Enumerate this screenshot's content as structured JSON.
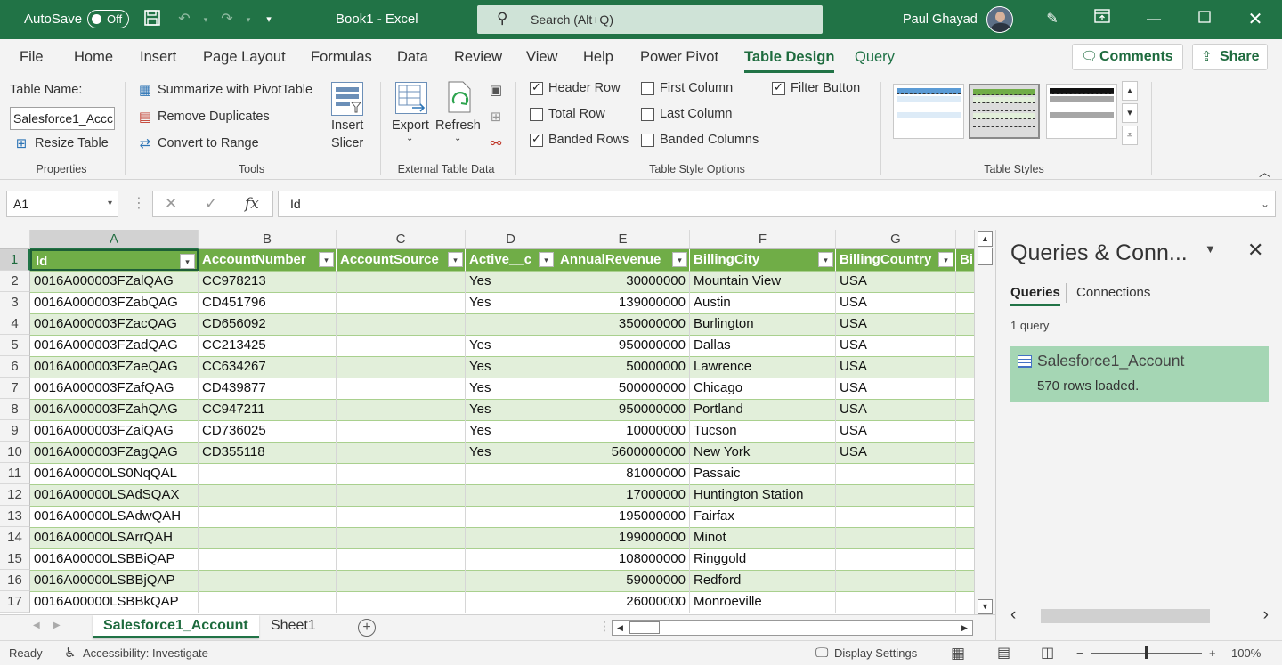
{
  "titlebar": {
    "autosave_label": "AutoSave",
    "autosave_state": "Off",
    "doc_title": "Book1  -  Excel",
    "search_placeholder": "Search (Alt+Q)",
    "user_name": "Paul Ghayad"
  },
  "tabs": [
    "File",
    "Home",
    "Insert",
    "Page Layout",
    "Formulas",
    "Data",
    "Review",
    "View",
    "Help",
    "Power Pivot",
    "Table Design",
    "Query"
  ],
  "active_tab": "Table Design",
  "actions": {
    "comments": "Comments",
    "share": "Share"
  },
  "ribbon": {
    "properties": {
      "table_name_label": "Table Name:",
      "table_name_value": "Salesforce1_Accc",
      "resize": "Resize Table",
      "group": "Properties"
    },
    "tools": {
      "summarize": "Summarize with PivotTable",
      "remove_dup": "Remove Duplicates",
      "convert": "Convert to Range",
      "insert_slicer_1": "Insert",
      "insert_slicer_2": "Slicer",
      "group": "Tools"
    },
    "external": {
      "export": "Export",
      "refresh": "Refresh",
      "group": "External Table Data"
    },
    "style_options": {
      "header_row": "Header Row",
      "total_row": "Total Row",
      "banded_rows": "Banded Rows",
      "first_column": "First Column",
      "last_column": "Last Column",
      "banded_columns": "Banded Columns",
      "filter_button": "Filter Button",
      "group": "Table Style Options"
    },
    "styles": {
      "group": "Table Styles"
    }
  },
  "formula_bar": {
    "name_box": "A1",
    "fx": "fx",
    "formula": "Id"
  },
  "grid": {
    "columns": [
      "A",
      "B",
      "C",
      "D",
      "E",
      "F",
      "G"
    ],
    "headers": [
      "Id",
      "AccountNumber",
      "AccountSource",
      "Active__c",
      "AnnualRevenue",
      "BillingCity",
      "BillingCountry",
      "Bil"
    ],
    "rows": [
      [
        "0016A000003FZalQAG",
        "CC978213",
        "",
        "Yes",
        "30000000",
        "Mountain View",
        "USA"
      ],
      [
        "0016A000003FZabQAG",
        "CD451796",
        "",
        "Yes",
        "139000000",
        "Austin",
        "USA"
      ],
      [
        "0016A000003FZacQAG",
        "CD656092",
        "",
        "",
        "350000000",
        "Burlington",
        "USA"
      ],
      [
        "0016A000003FZadQAG",
        "CC213425",
        "",
        "Yes",
        "950000000",
        "Dallas",
        "USA"
      ],
      [
        "0016A000003FZaeQAG",
        "CC634267",
        "",
        "Yes",
        "50000000",
        "Lawrence",
        "USA"
      ],
      [
        "0016A000003FZafQAG",
        "CD439877",
        "",
        "Yes",
        "500000000",
        "Chicago",
        "USA"
      ],
      [
        "0016A000003FZahQAG",
        "CC947211",
        "",
        "Yes",
        "950000000",
        "Portland",
        "USA"
      ],
      [
        "0016A000003FZaiQAG",
        "CD736025",
        "",
        "Yes",
        "10000000",
        "Tucson",
        "USA"
      ],
      [
        "0016A000003FZagQAG",
        "CD355118",
        "",
        "Yes",
        "5600000000",
        "New York",
        "USA"
      ],
      [
        "0016A00000LS0NqQAL",
        "",
        "",
        "",
        "81000000",
        "Passaic",
        ""
      ],
      [
        "0016A00000LSAdSQAX",
        "",
        "",
        "",
        "17000000",
        "Huntington Station",
        ""
      ],
      [
        "0016A00000LSAdwQAH",
        "",
        "",
        "",
        "195000000",
        "Fairfax",
        ""
      ],
      [
        "0016A00000LSArrQAH",
        "",
        "",
        "",
        "199000000",
        "Minot",
        ""
      ],
      [
        "0016A00000LSBBiQAP",
        "",
        "",
        "",
        "108000000",
        "Ringgold",
        ""
      ],
      [
        "0016A00000LSBBjQAP",
        "",
        "",
        "",
        "59000000",
        "Redford",
        ""
      ],
      [
        "0016A00000LSBBkQAP",
        "",
        "",
        "",
        "26000000",
        "Monroeville",
        ""
      ]
    ]
  },
  "sheets": [
    "Salesforce1_Account",
    "Sheet1"
  ],
  "active_sheet": "Salesforce1_Account",
  "queries_pane": {
    "title": "Queries & Conn...",
    "tabs": [
      "Queries",
      "Connections"
    ],
    "count": "1 query",
    "item_name": "Salesforce1_Account",
    "item_status": "570 rows loaded."
  },
  "status": {
    "mode": "Ready",
    "accessibility": "Accessibility: Investigate",
    "display_settings": "Display Settings",
    "zoom": "100%"
  },
  "colors": {
    "brand_green": "#217346",
    "table_header": "#70ad47",
    "band": "#e2efda",
    "query_item": "#a5d6b4"
  }
}
